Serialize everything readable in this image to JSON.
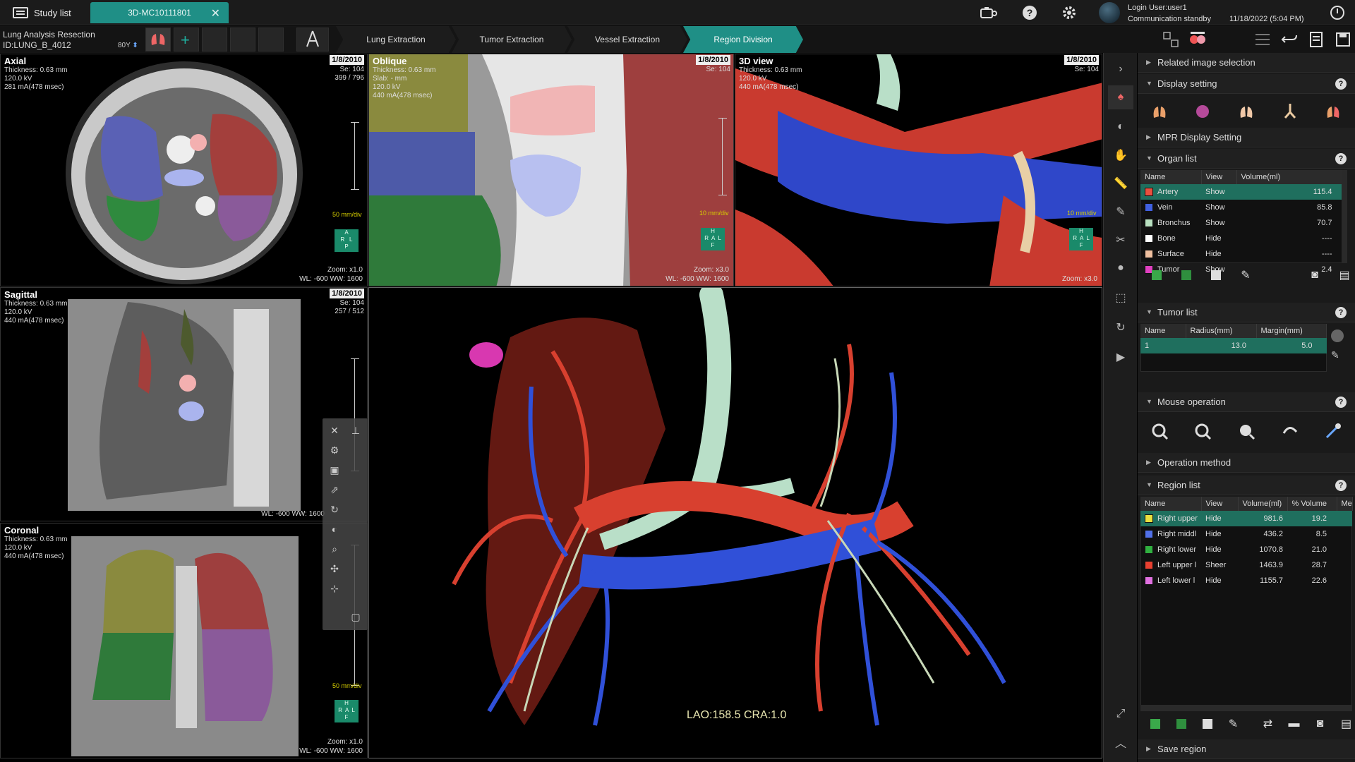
{
  "topbar": {
    "study_list_label": "Study list",
    "tab_label": "3D-MC10111801",
    "login_user": "Login User:user1",
    "comm_status": "Communication standby",
    "datetime": "11/18/2022 (5:04 PM)"
  },
  "app": {
    "title": "Lung Analysis Resection",
    "patient_id": "ID:LUNG_B_4012",
    "age": "80Y"
  },
  "steps": [
    {
      "label": "Lung Extraction",
      "active": false
    },
    {
      "label": "Tumor Extraction",
      "active": false
    },
    {
      "label": "Vessel Extraction",
      "active": false
    },
    {
      "label": "Region Division",
      "active": true
    }
  ],
  "viewports": {
    "axial": {
      "title": "Axial",
      "info": "Thickness: 0.63 mm\n120.0 kV\n281 mA(478 msec)",
      "date": "1/8/2010",
      "se": "Se: 104",
      "slice": "399 / 796",
      "scale": "50 mm/div",
      "zoom": "Zoom: x1.0",
      "wl": "WL: -600  WW: 1600",
      "orient": "A\nR   L\nP"
    },
    "oblique": {
      "title": "Oblique",
      "info": "Thickness: 0.63 mm\nSlab: - mm\n120.0 kV\n440 mA(478 msec)",
      "date": "1/8/2010",
      "se": "Se: 104",
      "scale": "10 mm/div",
      "zoom": "Zoom: x3.0",
      "wl": "WL: -600  WW: 1600",
      "orient": "H\nR  A  L\nF"
    },
    "view3d": {
      "title": "3D view",
      "info": "Thickness: 0.63 mm\n120.0 kV\n440 mA(478 msec)",
      "date": "1/8/2010",
      "se": "Se: 104",
      "scale": "10 mm/div",
      "zoom": "Zoom: x3.0",
      "orient": "H\nR  A  L\nF"
    },
    "sagittal": {
      "title": "Sagittal",
      "info": "Thickness: 0.63 mm\n120.0 kV\n440 mA(478 msec)",
      "date": "1/8/2010",
      "se": "Se: 104",
      "slice": "257 / 512",
      "wl": "WL: -600  WW: 1600"
    },
    "coronal": {
      "title": "Coronal",
      "info": "Thickness: 0.63 mm\n120.0 kV\n440 mA(478 msec)",
      "scale": "50 mm/div",
      "zoom": "Zoom: x1.0",
      "wl": "WL: -600  WW: 1600",
      "orient": "H\nR  A  L\nF"
    },
    "main3d": {
      "angle": "LAO:158.5 CRA:1.0"
    }
  },
  "panel": {
    "related_image": "Related image selection",
    "display_setting": "Display setting",
    "mpr_display": "MPR Display Setting",
    "organ_list": {
      "title": "Organ list",
      "headers": [
        "Name",
        "View",
        "Volume(ml)"
      ],
      "rows": [
        {
          "name": "Artery",
          "view": "Show",
          "volume": "115.4",
          "color": "#e8503f",
          "selected": true
        },
        {
          "name": "Vein",
          "view": "Show",
          "volume": "85.8",
          "color": "#4060e0",
          "selected": false
        },
        {
          "name": "Bronchus",
          "view": "Show",
          "volume": "70.7",
          "color": "#b8e0c0",
          "selected": false
        },
        {
          "name": "Bone",
          "view": "Hide",
          "volume": "----",
          "color": "#ffffff",
          "selected": false
        },
        {
          "name": "Surface",
          "view": "Hide",
          "volume": "----",
          "color": "#f0c0a0",
          "selected": false
        },
        {
          "name": "Tumor",
          "view": "Show",
          "volume": "2.4",
          "color": "#e040c0",
          "selected": false
        }
      ]
    },
    "tumor_list": {
      "title": "Tumor list",
      "headers": [
        "Name",
        "Radius(mm)",
        "Margin(mm)"
      ],
      "rows": [
        {
          "name": "1",
          "radius": "13.0",
          "margin": "5.0"
        }
      ]
    },
    "mouse_operation": "Mouse operation",
    "operation_method": "Operation method",
    "region_list": {
      "title": "Region list",
      "headers": [
        "Name",
        "View",
        "Volume(ml)",
        "% Volume",
        "Me"
      ],
      "rows": [
        {
          "name": "Right upper",
          "view": "Hide",
          "volume": "981.6",
          "pct": "19.2",
          "color": "#e8e040",
          "selected": true
        },
        {
          "name": "Right middl",
          "view": "Hide",
          "volume": "436.2",
          "pct": "8.5",
          "color": "#5070e8",
          "selected": false
        },
        {
          "name": "Right lower",
          "view": "Hide",
          "volume": "1070.8",
          "pct": "21.0",
          "color": "#30b040",
          "selected": false
        },
        {
          "name": "Left upper l",
          "view": "Sheer",
          "volume": "1463.9",
          "pct": "28.7",
          "color": "#e84030",
          "selected": false
        },
        {
          "name": "Left lower l",
          "view": "Hide",
          "volume": "1155.7",
          "pct": "22.6",
          "color": "#e070e0",
          "selected": false
        }
      ]
    },
    "save_region": "Save region"
  }
}
